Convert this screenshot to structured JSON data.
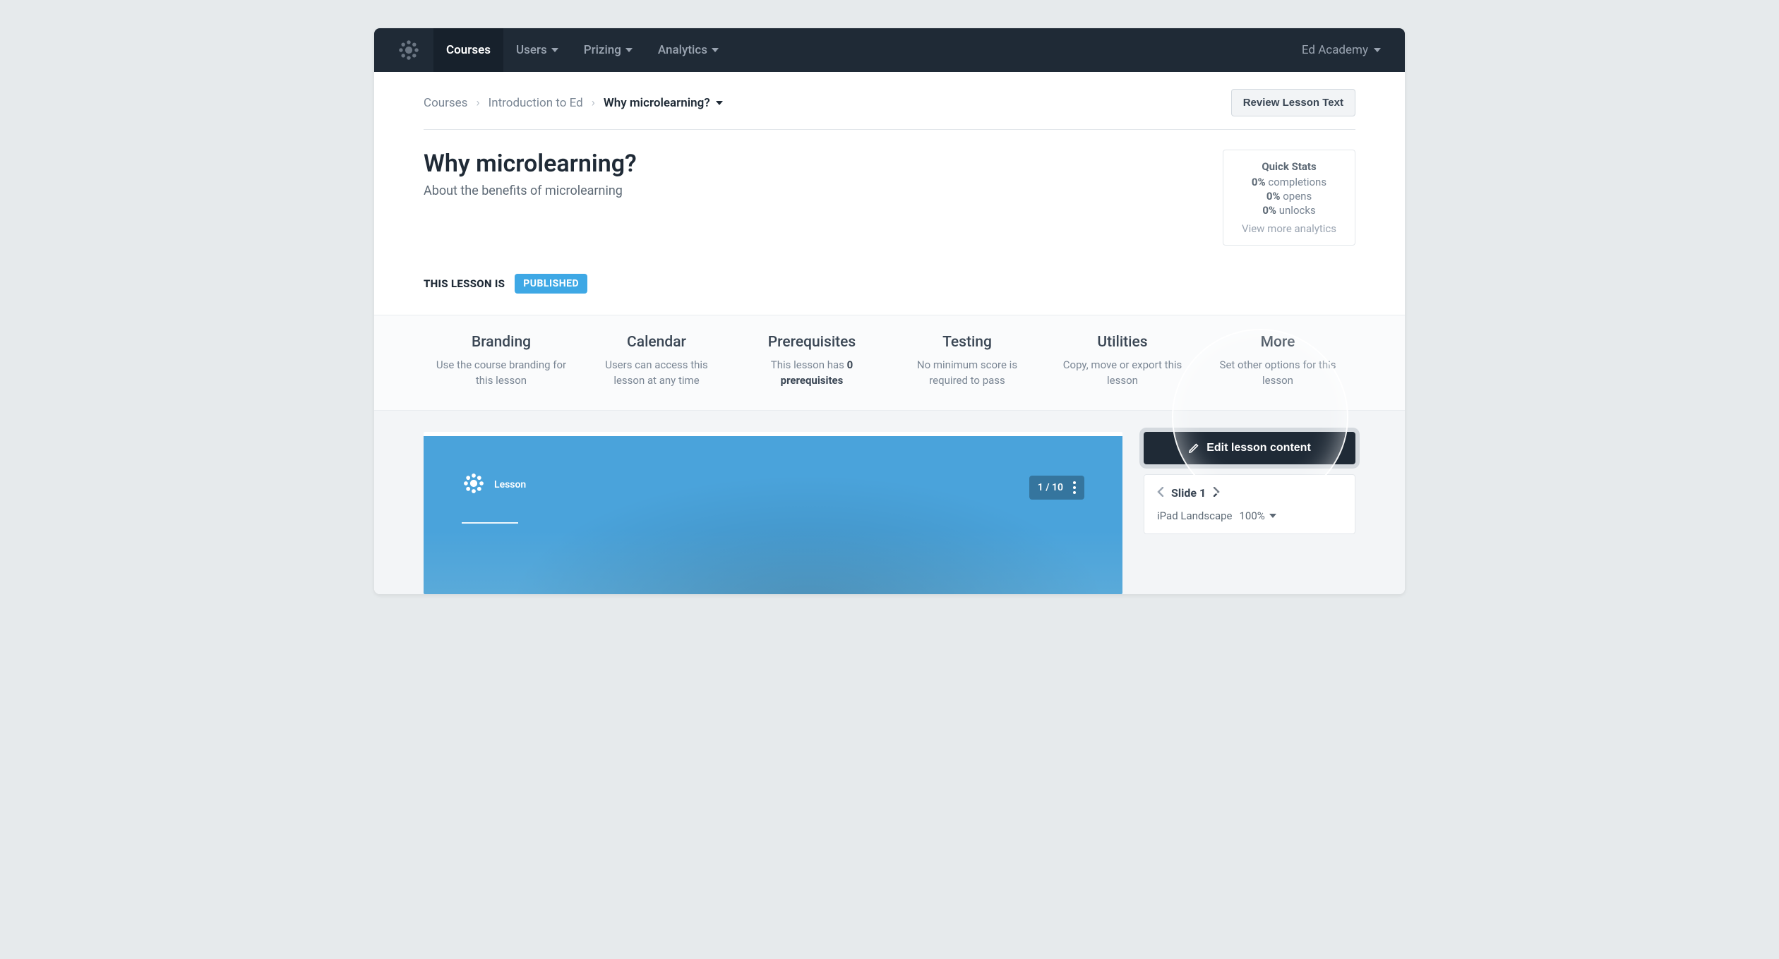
{
  "nav": {
    "items": [
      "Courses",
      "Users",
      "Prizing",
      "Analytics"
    ],
    "active_index": 0,
    "account": "Ed Academy"
  },
  "breadcrumb": {
    "root": "Courses",
    "course": "Introduction to Ed",
    "lesson": "Why microlearning?"
  },
  "actions": {
    "review_button": "Review Lesson Text",
    "edit_button": "Edit lesson content"
  },
  "title": "Why microlearning?",
  "subtitle": "About the benefits of microlearning",
  "status": {
    "label": "THIS LESSON IS",
    "badge": "PUBLISHED"
  },
  "quick_stats": {
    "title": "Quick Stats",
    "rows": [
      {
        "value": "0%",
        "label": "completions"
      },
      {
        "value": "0%",
        "label": "opens"
      },
      {
        "value": "0%",
        "label": "unlocks"
      }
    ],
    "link": "View more analytics"
  },
  "options": [
    {
      "title": "Branding",
      "desc_pre": "Use the course branding for this lesson",
      "bold": "",
      "desc_post": ""
    },
    {
      "title": "Calendar",
      "desc_pre": "Users can access this lesson at any time",
      "bold": "",
      "desc_post": ""
    },
    {
      "title": "Prerequisites",
      "desc_pre": "This lesson has ",
      "bold": "0 prerequisites",
      "desc_post": ""
    },
    {
      "title": "Testing",
      "desc_pre": "No minimum score is required to pass",
      "bold": "",
      "desc_post": ""
    },
    {
      "title": "Utilities",
      "desc_pre": "Copy, move or export this lesson",
      "bold": "",
      "desc_post": ""
    },
    {
      "title": "More",
      "desc_pre": "Set other options for this lesson",
      "bold": "",
      "desc_post": ""
    }
  ],
  "preview": {
    "tag": "Lesson",
    "counter": "1 / 10"
  },
  "side": {
    "slide_label": "Slide 1",
    "device": "iPad Landscape",
    "zoom": "100%"
  }
}
